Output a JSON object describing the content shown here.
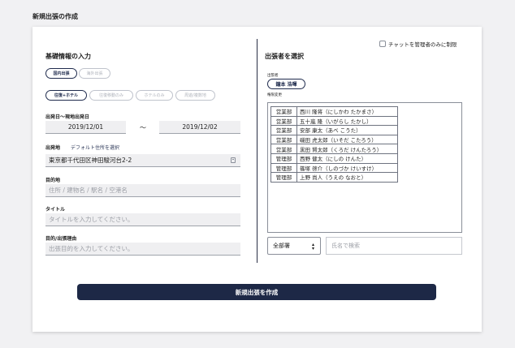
{
  "page": {
    "title": "新規出張の作成"
  },
  "basic_info": {
    "title": "基礎情報の入力",
    "trip_type": {
      "options": [
        "国内出張",
        "海外出張"
      ],
      "selected": 0
    },
    "transport": {
      "options": [
        "往復+ホテル",
        "往復移動のみ",
        "ホテルのみ",
        "周遊/複数地"
      ],
      "selected": 0
    },
    "dates": {
      "label": "出発日〜現地出発日",
      "start": "2019/12/01",
      "separator": "〜",
      "end": "2019/12/02"
    },
    "origin": {
      "label": "出発地",
      "link": "デフォルト住所を選択",
      "value": "東京都千代田区神田駿河台2-2"
    },
    "destination": {
      "label": "目的地",
      "placeholder": "住所 / 建物名 / 駅名 / 空港名"
    },
    "trip_title": {
      "label": "タイトル",
      "placeholder": "タイトルを入力してください。"
    },
    "purpose": {
      "label": "目的/出張理由",
      "placeholder": "出張目的を入力してください。"
    }
  },
  "traveler": {
    "title": "出張者を選択",
    "chat_admin_only": {
      "label": "チャットを管理者のみに制限",
      "checked": false
    },
    "travelers_label": "出張者",
    "selected_traveler": "鐘本 浩暉",
    "permission_change": "権限変更",
    "employees": [
      {
        "dept": "営業部",
        "name": "西川 隆将（にしかわ たかまさ）"
      },
      {
        "dept": "営業部",
        "name": "五十嵐 隆（いがらし たかし）"
      },
      {
        "dept": "営業部",
        "name": "安部 康太（あべ こうた）"
      },
      {
        "dept": "営業部",
        "name": "磯田 虎太郎（いそだ こたろう）"
      },
      {
        "dept": "営業部",
        "name": "黒田 賢太郎（くろだ けんたろう）"
      },
      {
        "dept": "管理部",
        "name": "西野 健太（にしの けんた）"
      },
      {
        "dept": "管理部",
        "name": "篠塚 啓介（しのづか けいすけ）"
      },
      {
        "dept": "管理部",
        "name": "上野 尚人（うえの なおと）"
      }
    ],
    "dept_filter": {
      "selected": "全部署"
    },
    "name_search": {
      "placeholder": "氏名で検索"
    }
  },
  "submit": {
    "label": "新規出張を作成"
  },
  "colors": {
    "accent": "#1d2846",
    "field_bg": "#efeff1"
  },
  "icons": {
    "calendar": "calendar-icon",
    "caret": "select-caret-icon"
  }
}
